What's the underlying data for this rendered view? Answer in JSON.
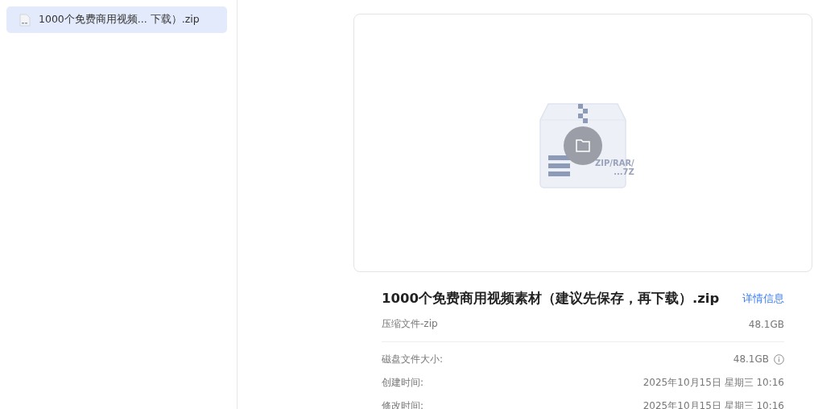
{
  "sidebar": {
    "items": [
      {
        "name": "1000个免费商用视频...  下载）.zip",
        "selected": true
      }
    ]
  },
  "preview": {
    "badge_lines": [
      "ZIP/RAR/",
      "...7Z"
    ]
  },
  "info": {
    "title": "1000个免费商用视频素材（建议先保存，再下载）.zip",
    "details_link": "详情信息",
    "type": "压缩文件-zip",
    "size": "48.1GB",
    "rows": [
      {
        "label": "磁盘文件大小:",
        "value": "48.1GB",
        "kind": "info"
      },
      {
        "label": "创建时间:",
        "value": "2025年10月15日 星期三 10:16",
        "kind": "plain"
      },
      {
        "label": "修改时间:",
        "value": "2025年10月15日 星期三 10:16",
        "kind": "plain"
      }
    ]
  }
}
